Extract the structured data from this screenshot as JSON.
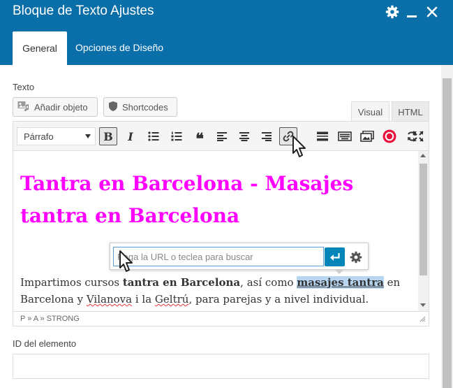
{
  "window": {
    "title": "Bloque de Texto Ajustes"
  },
  "tabs": [
    {
      "label": "General"
    },
    {
      "label": "Opciones de Diseño"
    }
  ],
  "text_label": "Texto",
  "media_buttons": {
    "add_object": "Añadir objeto",
    "shortcodes": "Shortcodes"
  },
  "editor_tabs": {
    "visual": "Visual",
    "html": "HTML"
  },
  "toolbar": {
    "format_select": "Párrafo",
    "buttons": [
      "bold",
      "italic",
      "bullet-list",
      "numbered-list",
      "blockquote",
      "align-left",
      "align-center",
      "align-right",
      "link",
      "read-more",
      "toolbar-toggle",
      "add-media",
      "plugin",
      "refresh",
      "fullscreen"
    ]
  },
  "content": {
    "heading": "Tantra en Barcelona - Masajes tantra en Barcelona",
    "para_1": "Impartimos cursos ",
    "para_bold": "tantra en Barcelona",
    "para_2": ", así como ",
    "para_link": "masajes tantra",
    "para_3": " en Barcelona y ",
    "para_w1": "Vilanova",
    "para_4": " i la ",
    "para_w2": "Geltrú",
    "para_5": ", para parejas y a nivel individual."
  },
  "statusbar": {
    "path": "P » A » STRONG"
  },
  "link_popup": {
    "placeholder": "Pega la URL o teclea para buscar"
  },
  "element_id_label": "ID del elemento",
  "colors": {
    "header": "#0a6ea8",
    "heading_text": "#ff00ff",
    "apply_button": "#0085ba",
    "highlight": "#b8d6f2"
  }
}
